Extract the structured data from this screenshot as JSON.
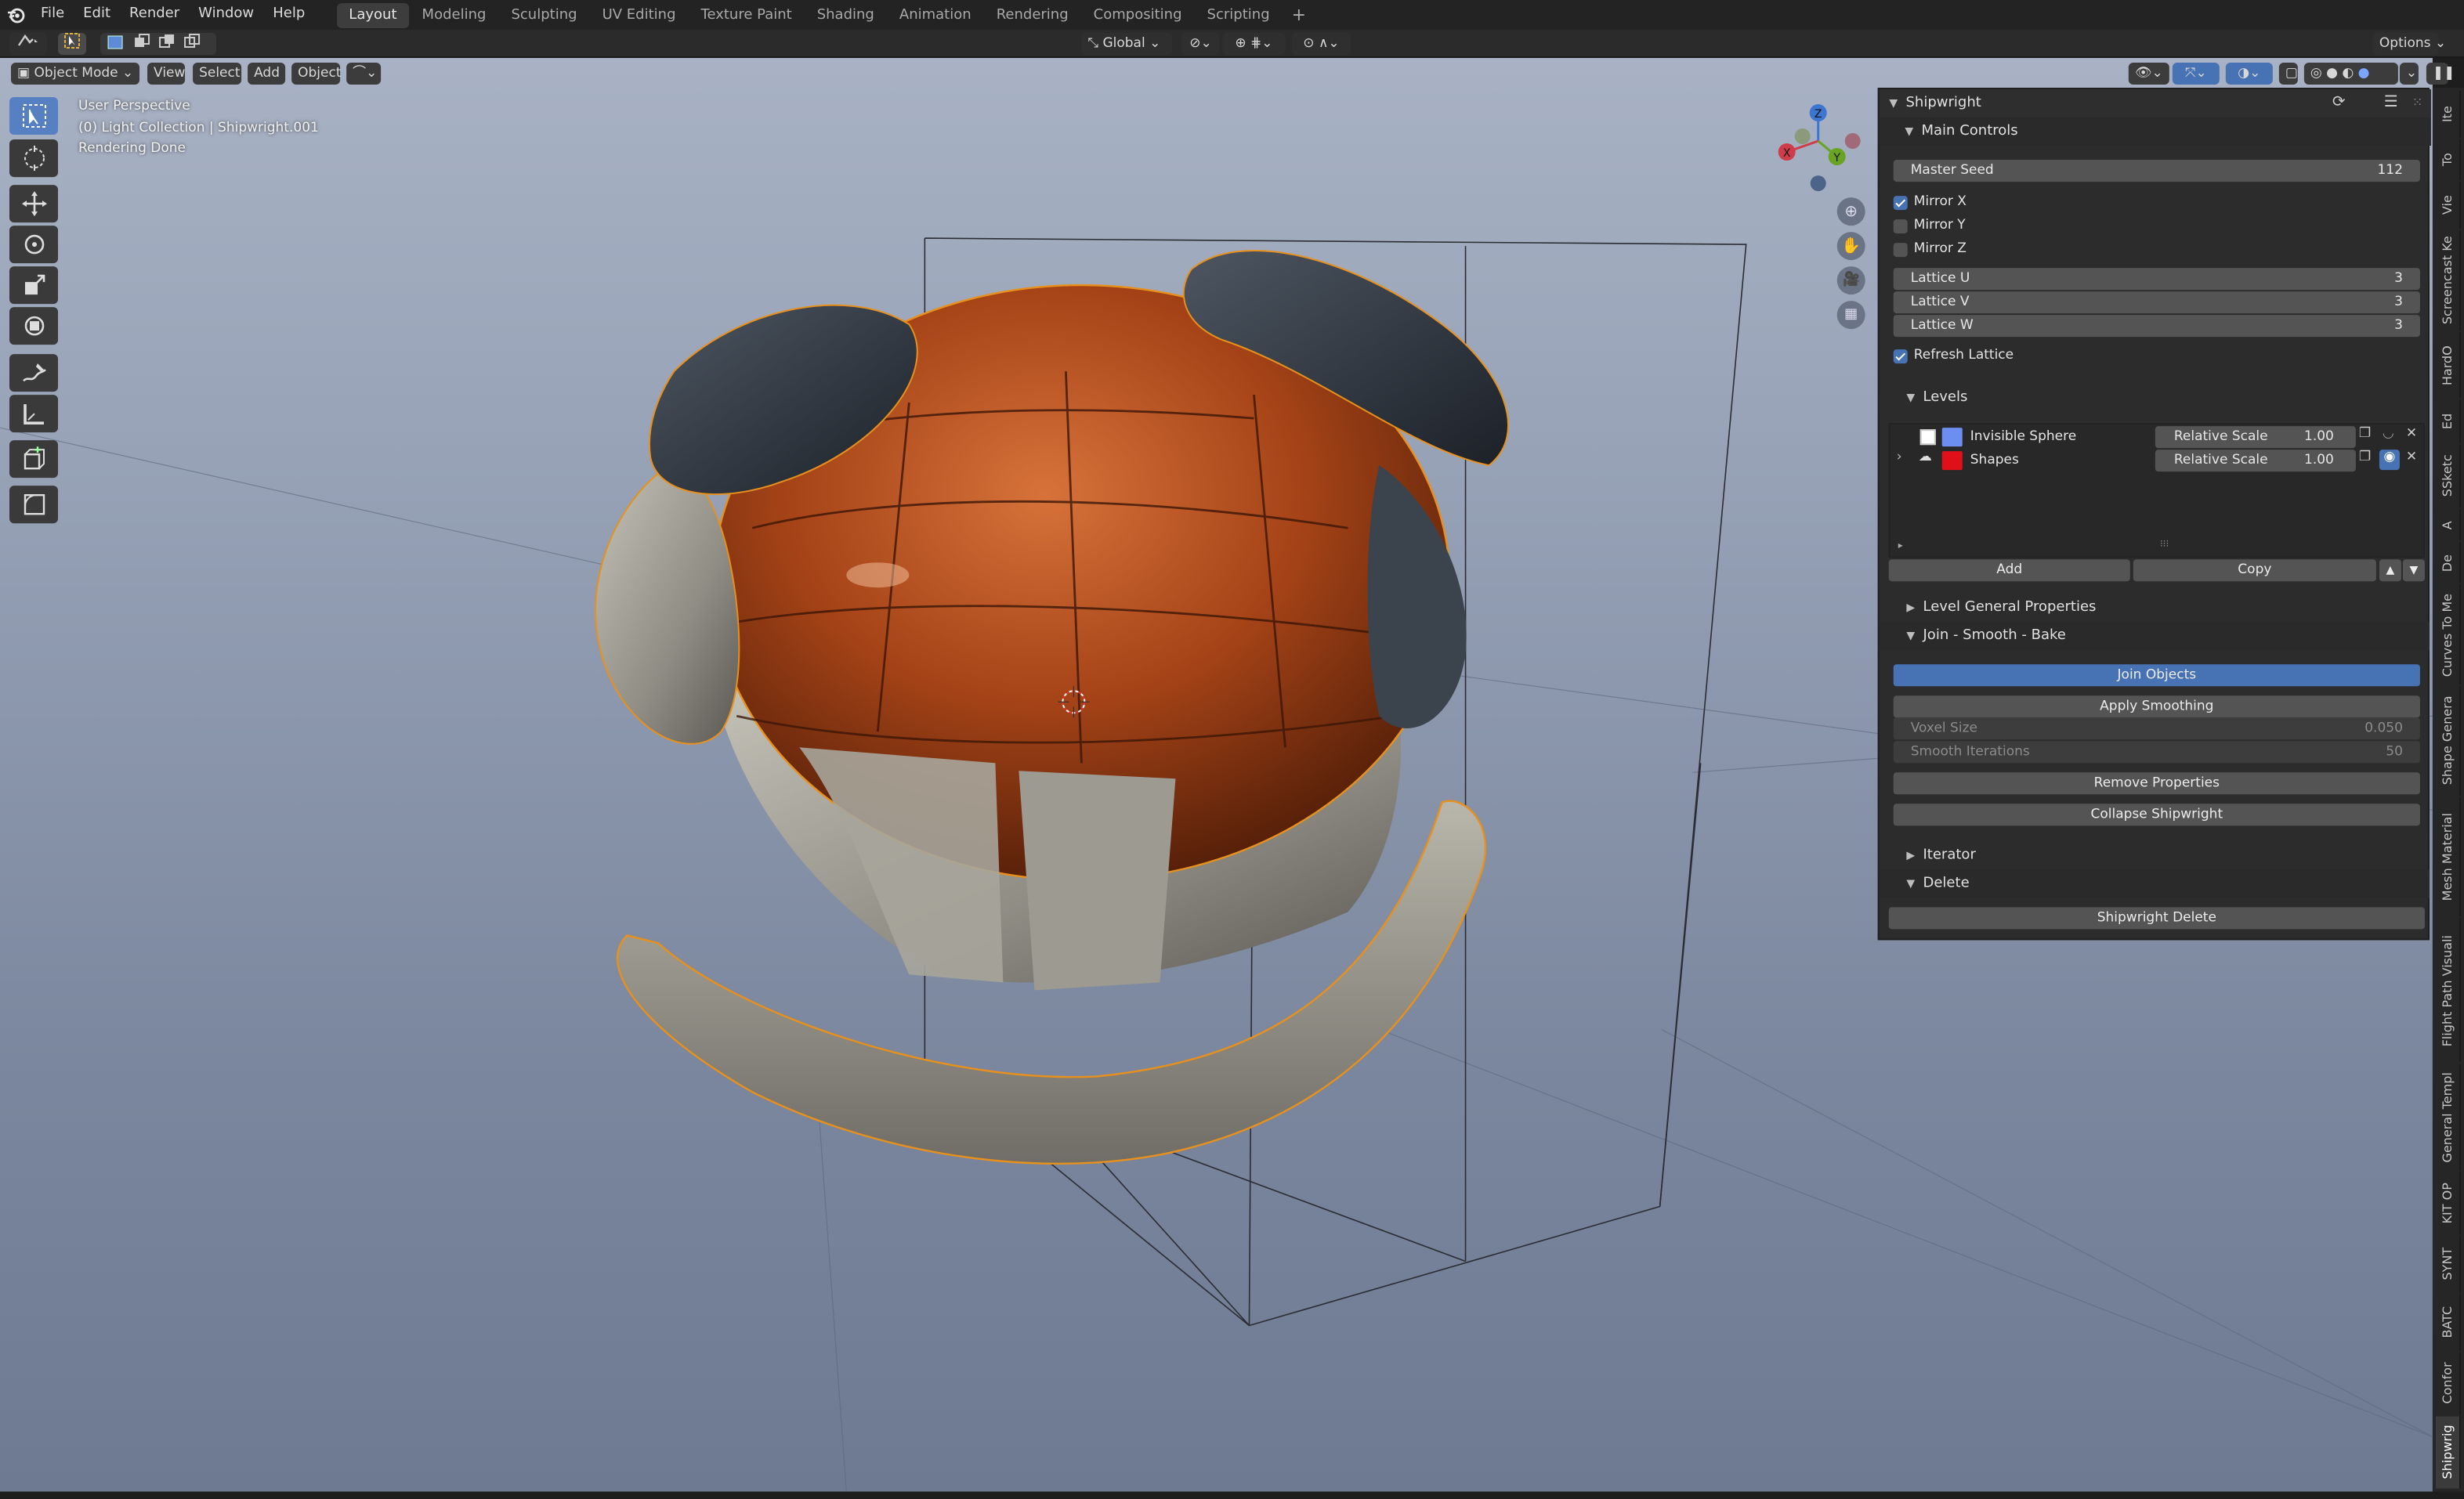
{
  "menu": [
    "File",
    "Edit",
    "Render",
    "Window",
    "Help"
  ],
  "workspaces": [
    {
      "label": "Layout",
      "active": true
    },
    {
      "label": "Modeling"
    },
    {
      "label": "Sculpting"
    },
    {
      "label": "UV Editing"
    },
    {
      "label": "Texture Paint"
    },
    {
      "label": "Shading"
    },
    {
      "label": "Animation"
    },
    {
      "label": "Rendering"
    },
    {
      "label": "Compositing"
    },
    {
      "label": "Scripting"
    }
  ],
  "workspace_add": "+",
  "toolrow": {
    "orientation": "Global",
    "options": "Options"
  },
  "header": {
    "mode": "Object Mode",
    "view": "View",
    "select": "Select",
    "add": "Add",
    "object": "Object"
  },
  "overlay": {
    "perspective": "User Perspective",
    "collection": "(0) Light Collection | Shipwright.001",
    "status": "Rendering Done"
  },
  "gizmo": {
    "x": "X",
    "y": "Y",
    "z": "Z"
  },
  "panel": {
    "title": "Shipwright",
    "main_controls": "Main Controls",
    "master_seed": {
      "label": "Master Seed",
      "value": "112"
    },
    "mirror_x": {
      "label": "Mirror X",
      "checked": true
    },
    "mirror_y": {
      "label": "Mirror Y",
      "checked": false
    },
    "mirror_z": {
      "label": "Mirror Z",
      "checked": false
    },
    "lattice_u": {
      "label": "Lattice U",
      "value": "3"
    },
    "lattice_v": {
      "label": "Lattice V",
      "value": "3"
    },
    "lattice_w": {
      "label": "Lattice W",
      "value": "3"
    },
    "refresh_lattice": {
      "label": "Refresh Lattice",
      "checked": true
    },
    "levels": "Levels",
    "level_rows": [
      {
        "name": "Invisible Sphere",
        "scale_label": "Relative Scale",
        "scale": "1.00",
        "color": "#6c8ef0"
      },
      {
        "name": "Shapes",
        "scale_label": "Relative Scale",
        "scale": "1.00",
        "color": "#e0101a"
      }
    ],
    "add": "Add",
    "copy": "Copy",
    "level_general": "Level General Properties",
    "join_smooth_bake": "Join - Smooth - Bake",
    "join_objects": "Join Objects",
    "apply_smoothing": "Apply Smoothing",
    "voxel_size": {
      "label": "Voxel Size",
      "value": "0.050"
    },
    "smooth_iterations": {
      "label": "Smooth Iterations",
      "value": "50"
    },
    "remove_properties": "Remove Properties",
    "collapse": "Collapse Shipwright",
    "iterator": "Iterator",
    "delete": "Delete",
    "shipwright_delete": "Shipwright Delete"
  },
  "side_tabs": [
    "Ite",
    "To",
    "Vie",
    "Screencast Ke",
    "HardO",
    "Ed",
    "SSketc",
    "A",
    "De",
    "Curves To Me",
    "Shape Genera",
    "Mesh Material",
    "Flight Path Visuali",
    "General Templ",
    "KIT OP",
    "SYNT",
    "BATC",
    "Confor",
    "Shipwrig"
  ]
}
